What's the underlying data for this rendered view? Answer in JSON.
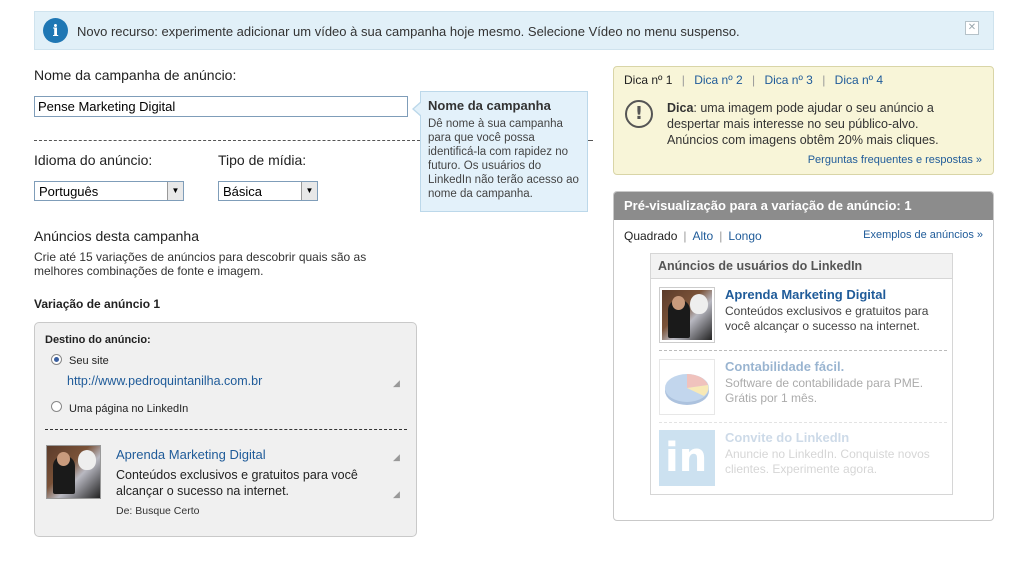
{
  "notice": {
    "text": "Novo recurso: experimente adicionar um vídeo à sua campanha hoje mesmo. Selecione Vídeo no menu suspenso.",
    "icon": "info-icon",
    "close_icon": "close-icon"
  },
  "campaign": {
    "name_label": "Nome da campanha de anúncio:",
    "name_value": "Pense Marketing Digital"
  },
  "tooltip": {
    "title": "Nome da campanha",
    "body": "Dê nome à sua campanha para que você possa identificá-la com rapidez no futuro. Os usuários do LinkedIn não terão acesso ao nome da campanha."
  },
  "language": {
    "label": "Idioma do anúncio:",
    "value": "Português"
  },
  "media": {
    "label": "Tipo de mídia:",
    "value": "Básica"
  },
  "ads_section": {
    "title": "Anúncios desta campanha",
    "desc_line1": "Crie até 15 variações de anúncios para descobrir quais são as",
    "desc_line2": "melhores combinações de fonte e imagem."
  },
  "variation": {
    "title": "Variação de anúncio 1",
    "destination_label": "Destino do anúncio:",
    "option_site": "Seu site",
    "site_url": "http://www.pedroquintanilha.com.br",
    "option_linkedin": "Uma página no LinkedIn",
    "ad_title": "Aprenda Marketing Digital",
    "ad_desc_line1": "Conteúdos exclusivos e gratuitos para você",
    "ad_desc_line2": "alcançar o sucesso na internet.",
    "from": "De: Busque Certo"
  },
  "tips": {
    "tabs": [
      "Dica nº 1",
      "Dica nº 2",
      "Dica nº 3",
      "Dica nº 4"
    ],
    "active_tab": 0,
    "bold": "Dica",
    "line1_rest": ": uma imagem pode ajudar o seu anúncio a",
    "line2": "despertar mais interesse no seu público-alvo.",
    "line3": "Anúncios com imagens obtêm 20% mais cliques.",
    "faq": "Perguntas frequentes e respostas »"
  },
  "preview": {
    "header": "Pré-visualização para a variação de anúncio: 1",
    "formats": [
      "Quadrado",
      "Alto",
      "Longo"
    ],
    "examples": "Exemplos de anúncios »",
    "box_title": "Anúncios de usuários do LinkedIn",
    "ads": [
      {
        "title": "Aprenda Marketing Digital",
        "desc": "Conteúdos exclusivos e gratuitos para você alcançar o sucesso na internet."
      },
      {
        "title": "Contabilidade fácil.",
        "desc": "Software de contabilidade para PME. Grátis por 1 mês."
      },
      {
        "title": "Convite do LinkedIn",
        "desc": "Anuncie no LinkedIn. Conquiste novos clientes. Experimente agora."
      }
    ]
  }
}
